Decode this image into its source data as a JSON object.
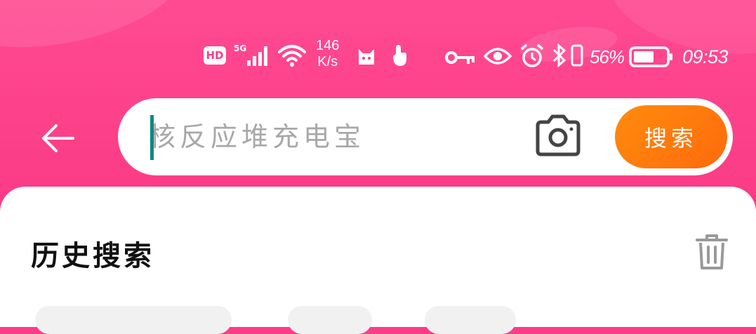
{
  "status_bar": {
    "hd_label": "HD",
    "network_label": "5G",
    "speed_value": "146",
    "speed_unit": "K/s",
    "battery_percent": "56%",
    "time": "09:53",
    "icons": [
      "hd-icon",
      "signal-icon",
      "wifi-icon",
      "cat-app-icon",
      "touch-icon",
      "key-icon",
      "eye-icon",
      "alarm-icon",
      "bluetooth-icon",
      "vibrate-icon",
      "battery-icon"
    ]
  },
  "search": {
    "placeholder": "核反应堆充电宝",
    "value": "",
    "button_label": "搜索"
  },
  "history": {
    "title": "历史搜索"
  },
  "colors": {
    "header_bg": "#fb3d88",
    "search_button": "#ff7a0c",
    "caret": "#0a8a82"
  }
}
